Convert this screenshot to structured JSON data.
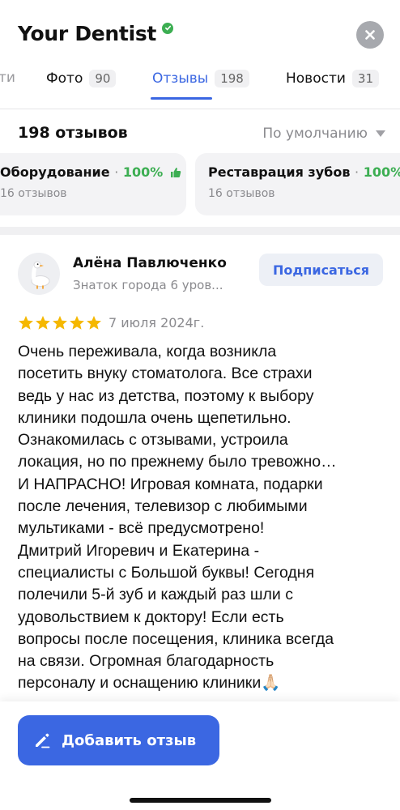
{
  "header": {
    "title": "Your Dentist",
    "verified_icon": "verified-badge-icon",
    "close_icon": "close-icon"
  },
  "tabs": [
    {
      "label": "ти",
      "count": ""
    },
    {
      "label": "Фото",
      "count": "90"
    },
    {
      "label": "Отзывы",
      "count": "198",
      "active": true
    },
    {
      "label": "Новости",
      "count": "31"
    }
  ],
  "reviews_summary": {
    "count_label": "198 отзывов",
    "sort_label": "По умолчанию"
  },
  "aspects": [
    {
      "name": "Оборудование",
      "separator": "·",
      "percent": "100%",
      "reviews": "16 отзывов"
    },
    {
      "name": "Реставрация зубов",
      "separator": "·",
      "percent": "100%",
      "reviews": "16 отзывов"
    }
  ],
  "review": {
    "author": "Алёна Павлюченко",
    "level": "Знаток города 6 уров...",
    "subscribe_label": "Подписаться",
    "rating": 5,
    "date": "7 июля 2024г.",
    "text": "Очень переживала, когда возникла\nпосетить внуку стоматолога. Все страхи\nведь у нас из детства, поэтому к выбору\nклиники подошла очень щепетильно.\nОзнакомилась с отзывами, устроила\nлокация, но по прежнему было тревожно…\nИ НАПРАСНО! Игровая комната, подарки\nпосле лечения, телевизор с любимыми\nмультиками - всё предусмотрено!\nДмитрий Игоревич и Екатерина -\nспециалисты с Большой буквы! Сегодня\nполечили 5-й зуб и каждый раз шли с\nудовольствием к доктору! Если есть\nвопросы после посещения, клиника всегда\nна связи. Огромная благодарность\nперсоналу и оснащению клиники🙏🏻"
  },
  "footer": {
    "add_review_label": "Добавить отзыв"
  },
  "colors": {
    "accent": "#3b67e2",
    "positive": "#3cae52",
    "star": "#f5b800",
    "muted": "#8a8a8e"
  }
}
